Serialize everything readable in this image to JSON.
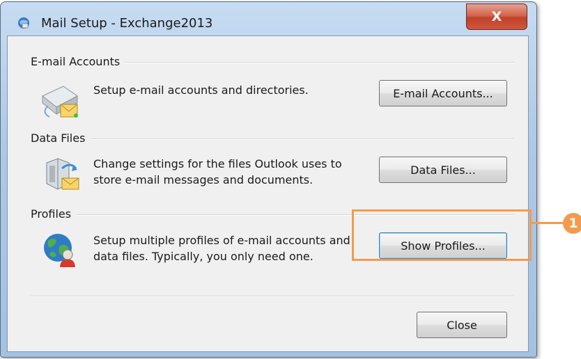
{
  "window": {
    "title": "Mail Setup - Exchange2013",
    "close_glyph": "X"
  },
  "groups": {
    "email_accounts": {
      "label": "E-mail Accounts",
      "description": "Setup e-mail accounts and directories.",
      "button_label": "E-mail Accounts...",
      "icon": "email-accounts-icon"
    },
    "data_files": {
      "label": "Data Files",
      "description": "Change settings for the files Outlook uses to\nstore e-mail messages and documents.",
      "button_label": "Data Files...",
      "icon": "data-files-icon"
    },
    "profiles": {
      "label": "Profiles",
      "description": "Setup multiple profiles of e-mail accounts and\ndata files. Typically, you only need one.",
      "button_label": "Show Profiles...",
      "icon": "profiles-icon"
    }
  },
  "footer": {
    "close_label": "Close"
  },
  "annotation": {
    "badge_number": "1",
    "color": "#f39b4d"
  }
}
